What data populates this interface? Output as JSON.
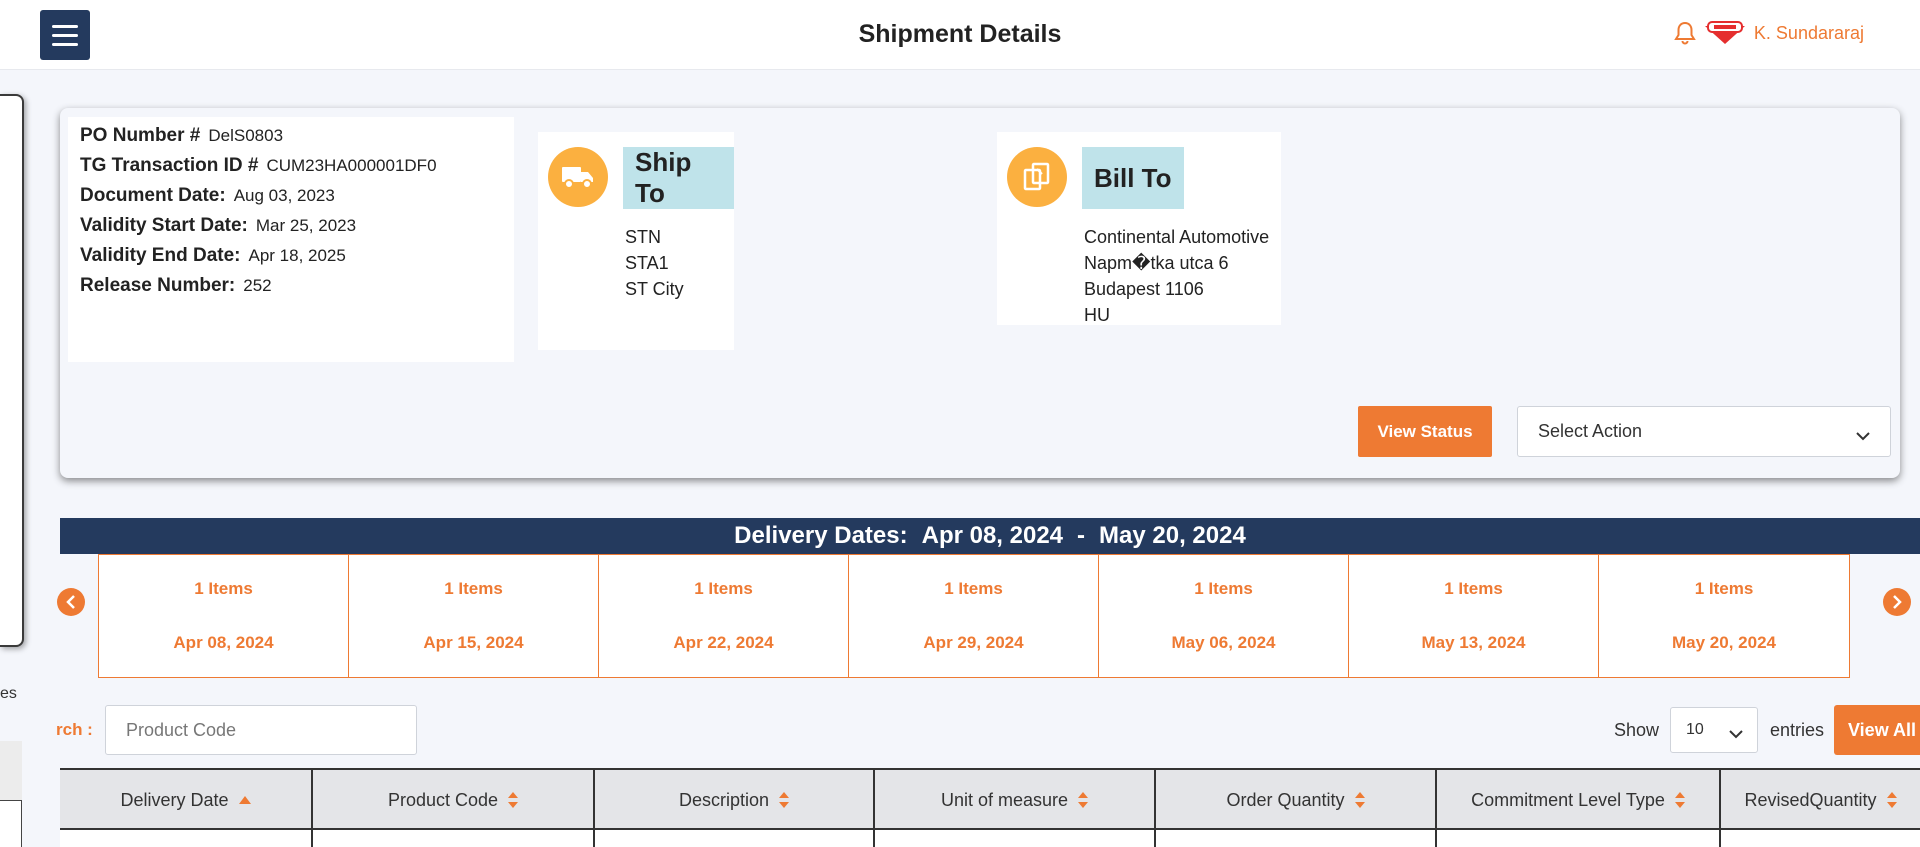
{
  "header": {
    "title": "Shipment Details",
    "user_name": "K. Sundararaj",
    "icons": {
      "menu": "hamburger-menu-icon",
      "notification": "bell-icon",
      "logo": "company-logo"
    }
  },
  "sidebar": {
    "fragment_text": "es"
  },
  "po_details": [
    {
      "label": "PO Number #",
      "value": "DelS0803"
    },
    {
      "label": "TG Transaction ID #",
      "value": "CUM23HA000001DF0"
    },
    {
      "label": "Document Date:",
      "value": "Aug 03, 2023"
    },
    {
      "label": "Validity Start Date:",
      "value": "Mar 25, 2023"
    },
    {
      "label": "Validity End Date:",
      "value": "Apr 18, 2025"
    },
    {
      "label": "Release Number:",
      "value": "252"
    }
  ],
  "ship_to": {
    "title": "Ship To",
    "icon": "truck-icon",
    "lines": [
      "STN",
      "STA1",
      "ST City"
    ]
  },
  "bill_to": {
    "title": "Bill To",
    "icon": "documents-icon",
    "lines": [
      "Continental Automotive",
      "Napm�tka utca 6",
      "Budapest 1106",
      "HU"
    ]
  },
  "actions": {
    "view_status": "View Status",
    "select_action": "Select Action"
  },
  "delivery": {
    "label": "Delivery Dates:",
    "start": "Apr 08, 2024",
    "separator": "-",
    "end": "May 20, 2024",
    "cells": [
      {
        "items": "1 Items",
        "date": "Apr 08, 2024"
      },
      {
        "items": "1 Items",
        "date": "Apr 15, 2024"
      },
      {
        "items": "1 Items",
        "date": "Apr 22, 2024"
      },
      {
        "items": "1 Items",
        "date": "Apr 29, 2024"
      },
      {
        "items": "1 Items",
        "date": "May 06, 2024"
      },
      {
        "items": "1 Items",
        "date": "May 13, 2024"
      },
      {
        "items": "1 Items",
        "date": "May 20, 2024"
      }
    ]
  },
  "search": {
    "label": "rch :",
    "placeholder": "Product Code"
  },
  "entries": {
    "show": "Show",
    "value": "10",
    "suffix": "entries",
    "view_all": "View All"
  },
  "table": {
    "columns": [
      {
        "label": "Delivery Date",
        "sort": "asc"
      },
      {
        "label": "Product Code",
        "sort": "both"
      },
      {
        "label": "Description",
        "sort": "both"
      },
      {
        "label": "Unit of measure",
        "sort": "both"
      },
      {
        "label": "Order Quantity",
        "sort": "both"
      },
      {
        "label": "Commitment Level Type",
        "sort": "both"
      },
      {
        "label": "RevisedQuantity",
        "sort": "both"
      }
    ]
  },
  "colors": {
    "accent": "#ee7a33",
    "navy": "#243a5e",
    "icon_circle": "#fbb040",
    "title_bg": "#bfe3ea"
  }
}
